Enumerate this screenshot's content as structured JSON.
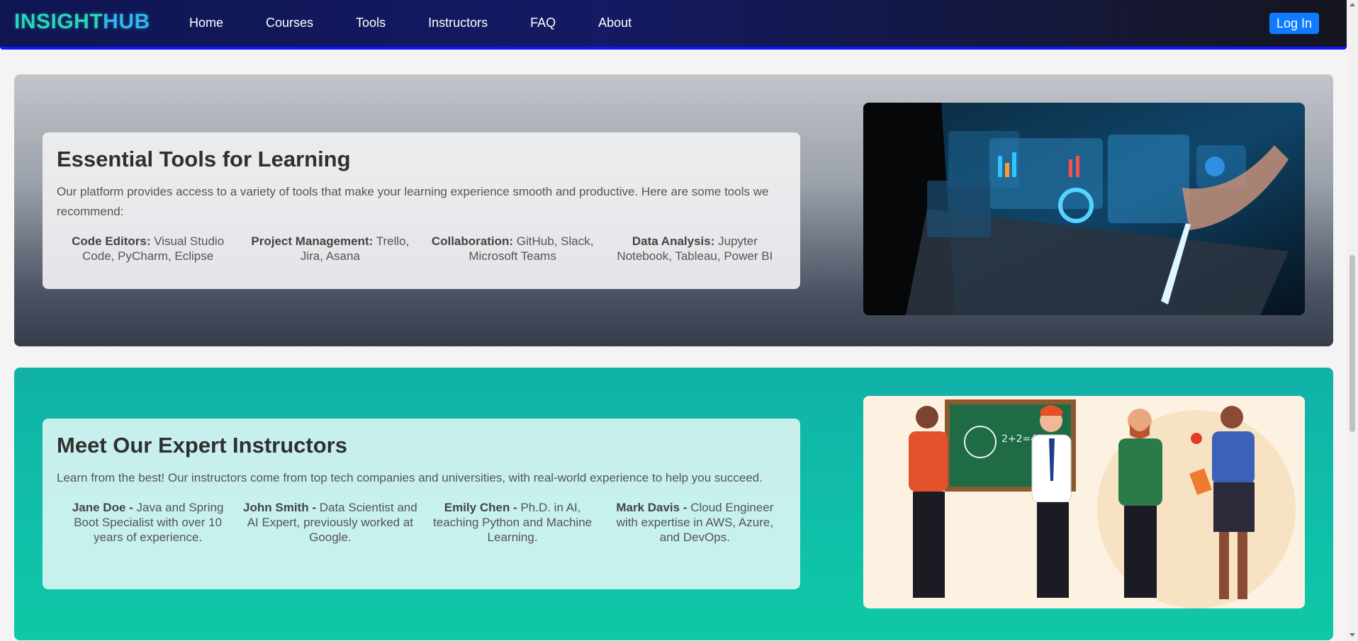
{
  "nav": {
    "logo_part1": "INSIGHT",
    "logo_part2": "HUB",
    "links": [
      "Home",
      "Courses",
      "Tools",
      "Instructors",
      "FAQ",
      "About"
    ],
    "login_label": "Log In"
  },
  "tools_section": {
    "title": "Essential Tools for Learning",
    "description": "Our platform provides access to a variety of tools that make your learning experience smooth and productive. Here are some tools we recommend:",
    "items": [
      {
        "label": "Code Editors:",
        "text": " Visual Studio Code, PyCharm, Eclipse"
      },
      {
        "label": "Project Management:",
        "text": " Trello, Jira, Asana"
      },
      {
        "label": "Collaboration:",
        "text": " GitHub, Slack, Microsoft Teams"
      },
      {
        "label": "Data Analysis:",
        "text": " Jupyter Notebook, Tableau, Power BI"
      }
    ],
    "image_alt": "Person using laptop with holographic data analytics dashboards"
  },
  "instructors_section": {
    "title": "Meet Our Expert Instructors",
    "description": "Learn from the best! Our instructors come from top tech companies and universities, with real-world experience to help you succeed.",
    "items": [
      {
        "label": "Jane Doe -",
        "text": " Java and Spring Boot Specialist with over 10 years of experience."
      },
      {
        "label": "John Smith -",
        "text": " Data Scientist and AI Expert, previously worked at Google."
      },
      {
        "label": "Emily Chen -",
        "text": " Ph.D. in AI, teaching Python and Machine Learning."
      },
      {
        "label": "Mark Davis -",
        "text": " Cloud Engineer with expertise in AWS, Azure, and DevOps."
      }
    ],
    "image_alt": "Illustration of four teachers in front of a chalkboard"
  }
}
